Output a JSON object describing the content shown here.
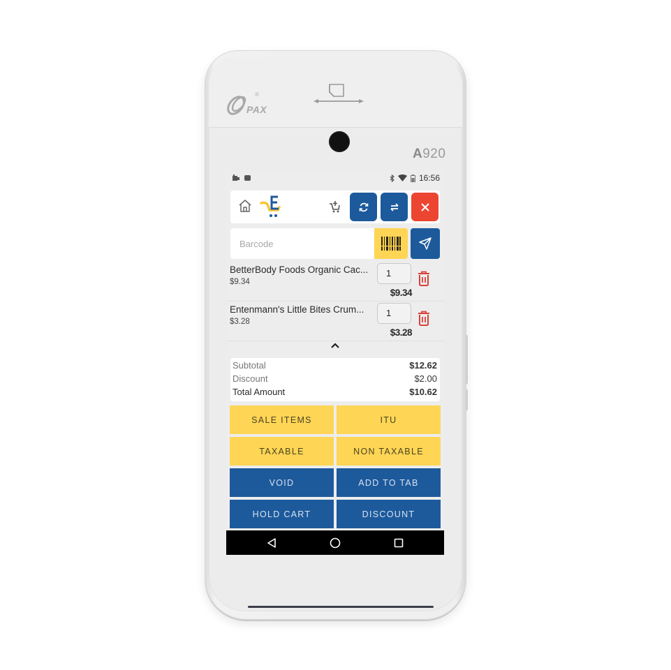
{
  "device": {
    "brand": "PAX",
    "registered_mark": "®",
    "model_prefix": "A",
    "model_number": "920"
  },
  "status_bar": {
    "left_icons": [
      "notification-app-icon",
      "android-icon"
    ],
    "right_icons": [
      "bluetooth-icon",
      "wifi-icon",
      "battery-icon"
    ],
    "time": "16:56"
  },
  "topbar": {
    "home_icon": "home-icon",
    "logo_icon": "cart-e-logo-icon",
    "add_to_cart_icon": "cart-add-icon",
    "buttons": [
      {
        "name": "refresh",
        "icon": "refresh-icon",
        "color": "#1d5a9c"
      },
      {
        "name": "switch",
        "icon": "swap-arrows-icon",
        "color": "#1d5a9c"
      },
      {
        "name": "close",
        "icon": "close-icon",
        "color": "#ec4532"
      }
    ]
  },
  "barcode": {
    "placeholder": "Barcode",
    "value": "",
    "scan_icon": "barcode-scan-icon",
    "send_icon": "send-icon"
  },
  "cart": {
    "items": [
      {
        "name": "BetterBody Foods Organic Cac...",
        "unit_price": "$9.34",
        "quantity": "1",
        "line_total": "$9.34"
      },
      {
        "name": "Entenmann's Little Bites Crum...",
        "unit_price": "$3.28",
        "quantity": "1",
        "line_total": "$3.28"
      }
    ]
  },
  "totals": {
    "subtotal_label": "Subtotal",
    "subtotal_value": "$12.62",
    "discount_label": "Discount",
    "discount_value": "$2.00",
    "total_label": "Total Amount",
    "total_value": "$10.62"
  },
  "actions": [
    {
      "label": "SALE ITEMS",
      "style": "yellow"
    },
    {
      "label": "ITU",
      "style": "yellow"
    },
    {
      "label": "TAXABLE",
      "style": "yellow"
    },
    {
      "label": "NON TAXABLE",
      "style": "yellow"
    },
    {
      "label": "VOID",
      "style": "blue"
    },
    {
      "label": "ADD TO TAB",
      "style": "blue"
    },
    {
      "label": "HOLD CART",
      "style": "blue"
    },
    {
      "label": "DISCOUNT",
      "style": "blue"
    }
  ],
  "colors": {
    "primary_blue": "#1d5a9c",
    "accent_yellow": "#fed555",
    "danger_red": "#ec4532",
    "trash_red": "#d9413a"
  },
  "nav_bar": [
    "back-icon",
    "home-circle-icon",
    "recents-icon"
  ]
}
